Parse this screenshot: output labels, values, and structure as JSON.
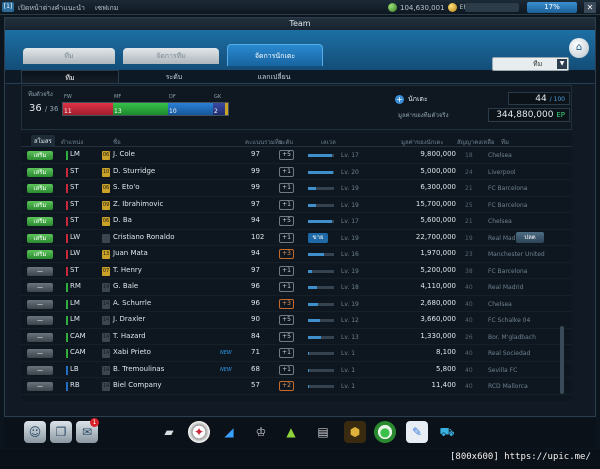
{
  "topbar": {
    "badge": "[1]",
    "menu": [
      "เปิดหน้าต่างคำแนะนำ",
      "เซฟเกม"
    ],
    "coins": "104,630,001",
    "ep_label": "EP",
    "battery": "17%",
    "close": "✕"
  },
  "window_title": "Team",
  "main_tabs": [
    {
      "label": "ทีม"
    },
    {
      "label": "จัดการทีม"
    },
    {
      "label": "จัดการนักเตะ"
    }
  ],
  "sub_tabs": [
    {
      "label": "ทีม"
    },
    {
      "label": "ระดับ"
    },
    {
      "label": "แลกเปลี่ยน"
    }
  ],
  "filter_dropdown": {
    "value": "ทีม",
    "arrow": "▼"
  },
  "summary": {
    "squad_label": "ทีมตัวจริง",
    "squad_count": "36",
    "squad_max": "/ 36",
    "positions": [
      {
        "label": "FW",
        "count": "11",
        "color": "#c8283a"
      },
      {
        "label": "MF",
        "count": "13",
        "color": "#2fae3e"
      },
      {
        "label": "DF",
        "count": "10",
        "color": "#1f6fc4"
      },
      {
        "label": "GK",
        "count": "2",
        "color": "#2a3a8a"
      }
    ],
    "players_label": "นักเตะ",
    "players_count": "44",
    "players_max": "/ 100",
    "value_label": "มูลค่าของทีมตัวจริง",
    "value": "344,880,000",
    "value_unit": "EP"
  },
  "columns": {
    "status": "สโมสร",
    "position": "ตำแหน่ง",
    "name": "ชื่อ",
    "ovr": "คะแนนรวมทีม",
    "level": "ระดับ",
    "exp": "เลเวล",
    "price": "มูลค่าของนักเตะ",
    "contract": "สัญญาคงเหลือ",
    "team": "ทีม"
  },
  "players": [
    {
      "status": "เสริม",
      "status_type": "starter",
      "pos": "LM",
      "pos_color": "#2fae3e",
      "season": "06",
      "season_color": "#c9a227",
      "name": "J. Cole",
      "new": "",
      "ovr": "97",
      "enh": "+5",
      "enh_type": "grey",
      "lv_fill": 0.92,
      "lv": "Lv. 17",
      "price": "9,800,000",
      "contract": "18",
      "team": "Chelsea",
      "action": ""
    },
    {
      "status": "เสริม",
      "status_type": "starter",
      "pos": "ST",
      "pos_color": "#c8283a",
      "season": "10",
      "season_color": "#c9a227",
      "name": "D. Sturridge",
      "new": "",
      "ovr": "99",
      "enh": "+1",
      "enh_type": "grey",
      "lv_fill": 0.95,
      "lv": "Lv. 20",
      "price": "5,000,000",
      "contract": "24",
      "team": "Liverpool",
      "action": ""
    },
    {
      "status": "เสริม",
      "status_type": "starter",
      "pos": "ST",
      "pos_color": "#c8283a",
      "season": "06",
      "season_color": "#c9a227",
      "name": "S. Eto'o",
      "new": "",
      "ovr": "99",
      "enh": "+1",
      "enh_type": "grey",
      "lv_fill": 0.3,
      "lv": "Lv. 19",
      "price": "6,300,000",
      "contract": "21",
      "team": "FC Barcelona",
      "action": ""
    },
    {
      "status": "เสริม",
      "status_type": "starter",
      "pos": "ST",
      "pos_color": "#c8283a",
      "season": "09",
      "season_color": "#c9a227",
      "name": "Z. Ibrahimovic",
      "new": "",
      "ovr": "97",
      "enh": "+1",
      "enh_type": "grey",
      "lv_fill": 0.3,
      "lv": "Lv. 19",
      "price": "15,700,000",
      "contract": "25",
      "team": "FC Barcelona",
      "action": ""
    },
    {
      "status": "เสริม",
      "status_type": "starter",
      "pos": "ST",
      "pos_color": "#c8283a",
      "season": "06",
      "season_color": "#c9a227",
      "name": "D. Ba",
      "new": "",
      "ovr": "94",
      "enh": "+5",
      "enh_type": "grey",
      "lv_fill": 0.92,
      "lv": "Lv. 17",
      "price": "5,600,000",
      "contract": "21",
      "team": "Chelsea",
      "action": ""
    },
    {
      "status": "เสริม",
      "status_type": "starter",
      "pos": "LW",
      "pos_color": "#c8283a",
      "season": "",
      "season_color": "#3c4650",
      "name": "Cristiano Ronaldo",
      "new": "",
      "ovr": "102",
      "enh": "+1",
      "enh_type": "grey",
      "lv_fill": 0.0,
      "lv": "Lv. 19",
      "price": "22,700,000",
      "contract": "19",
      "team": "Real Madrid",
      "action": "ปลด",
      "swap": "ขาย"
    },
    {
      "status": "เสริม",
      "status_type": "starter",
      "pos": "LW",
      "pos_color": "#c8283a",
      "season": "13",
      "season_color": "#c9a227",
      "name": "Juan Mata",
      "new": "",
      "ovr": "94",
      "enh": "+3",
      "enh_type": "orange",
      "lv_fill": 0.6,
      "lv": "Lv. 16",
      "price": "1,970,000",
      "contract": "23",
      "team": "Manchester United",
      "action": ""
    },
    {
      "status": "",
      "status_type": "bench",
      "pos": "ST",
      "pos_color": "#c8283a",
      "season": "07",
      "season_color": "#c9a227",
      "name": "T. Henry",
      "new": "",
      "ovr": "97",
      "enh": "+1",
      "enh_type": "grey",
      "lv_fill": 0.15,
      "lv": "Lv. 19",
      "price": "5,200,000",
      "contract": "38",
      "team": "FC Barcelona",
      "action": ""
    },
    {
      "status": "",
      "status_type": "bench",
      "pos": "RM",
      "pos_color": "#2fae3e",
      "season": "14",
      "season_color": "#3c4650",
      "name": "G. Bale",
      "new": "",
      "ovr": "96",
      "enh": "+1",
      "enh_type": "grey",
      "lv_fill": 0.35,
      "lv": "Lv. 18",
      "price": "4,110,000",
      "contract": "40",
      "team": "Real Madrid",
      "action": ""
    },
    {
      "status": "",
      "status_type": "bench",
      "pos": "LM",
      "pos_color": "#2fae3e",
      "season": "14",
      "season_color": "#3c4650",
      "name": "A. Schurrle",
      "new": "",
      "ovr": "96",
      "enh": "+3",
      "enh_type": "orange",
      "lv_fill": 0.4,
      "lv": "Lv. 19",
      "price": "2,680,000",
      "contract": "40",
      "team": "Chelsea",
      "action": ""
    },
    {
      "status": "",
      "status_type": "bench",
      "pos": "LM",
      "pos_color": "#2fae3e",
      "season": "14",
      "season_color": "#3c4650",
      "name": "J. Draxler",
      "new": "",
      "ovr": "90",
      "enh": "+5",
      "enh_type": "grey",
      "lv_fill": 0.45,
      "lv": "Lv. 12",
      "price": "3,660,000",
      "contract": "40",
      "team": "FC Schalke 04",
      "action": ""
    },
    {
      "status": "",
      "status_type": "bench",
      "pos": "CAM",
      "pos_color": "#2fae3e",
      "season": "14",
      "season_color": "#3c4650",
      "name": "T. Hazard",
      "new": "",
      "ovr": "84",
      "enh": "+5",
      "enh_type": "grey",
      "lv_fill": 0.5,
      "lv": "Lv. 13",
      "price": "1,330,000",
      "contract": "26",
      "team": "Bor. M'gladbach",
      "action": ""
    },
    {
      "status": "",
      "status_type": "bench",
      "pos": "CAM",
      "pos_color": "#2fae3e",
      "season": "14",
      "season_color": "#3c4650",
      "name": "Xabi Prieto",
      "new": "NEW",
      "ovr": "71",
      "enh": "+1",
      "enh_type": "grey",
      "lv_fill": 0.05,
      "lv": "Lv. 1",
      "price": "8,100",
      "contract": "40",
      "team": "Real Sociedad",
      "action": ""
    },
    {
      "status": "",
      "status_type": "bench",
      "pos": "LB",
      "pos_color": "#1f6fc4",
      "season": "14",
      "season_color": "#3c4650",
      "name": "B. Tremoulinas",
      "new": "NEW",
      "ovr": "68",
      "enh": "+1",
      "enh_type": "grey",
      "lv_fill": 0.05,
      "lv": "Lv. 1",
      "price": "5,800",
      "contract": "40",
      "team": "Sevilla FC",
      "action": ""
    },
    {
      "status": "",
      "status_type": "bench",
      "pos": "RB",
      "pos_color": "#1f6fc4",
      "season": "14",
      "season_color": "#3c4650",
      "name": "Biel Company",
      "new": "",
      "ovr": "57",
      "enh": "+2",
      "enh_type": "orange",
      "lv_fill": 0.05,
      "lv": "Lv. 1",
      "price": "11,400",
      "contract": "40",
      "team": "RCD Mallorca",
      "action": ""
    }
  ],
  "dock": {
    "notify_count": "1",
    "icons": [
      "profile-icon",
      "cards-icon",
      "mail-icon",
      "boots-icon",
      "ball-icon",
      "cleat-icon",
      "trophy-icon",
      "cone-icon",
      "ticket-icon",
      "medal-icon",
      "club-icon",
      "shop-icon",
      "cart-icon"
    ]
  },
  "watermark": "[800x600] https://upic.me/"
}
